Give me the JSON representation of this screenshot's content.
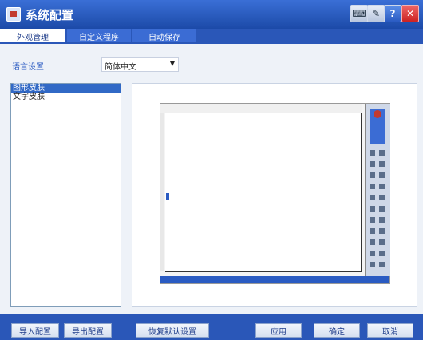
{
  "window": {
    "title": "系统配置",
    "controls": [
      {
        "name": "keyboard-icon",
        "glyph": "⌨"
      },
      {
        "name": "pen-settings-icon",
        "glyph": "✎"
      },
      {
        "name": "help-icon",
        "glyph": "?"
      },
      {
        "name": "close-icon",
        "glyph": "✕"
      }
    ]
  },
  "tabs": [
    {
      "label": "外观管理",
      "active": true
    },
    {
      "label": "自定义程序",
      "active": false
    },
    {
      "label": "自动保存",
      "active": false
    }
  ],
  "language": {
    "label": "语言设置",
    "selected": "简体中文"
  },
  "skins": {
    "items": [
      {
        "label": "图形皮肤",
        "selected": true
      },
      {
        "label": "文字皮肤",
        "selected": false
      }
    ]
  },
  "buttons": {
    "import": "导入配置",
    "export": "导出配置",
    "restore": "恢复默认设置",
    "apply": "应用",
    "ok": "确定",
    "cancel": "取消"
  },
  "colors": {
    "titlebar": "#2a5bc2",
    "accent": "#3169c6",
    "close": "#d33333"
  }
}
